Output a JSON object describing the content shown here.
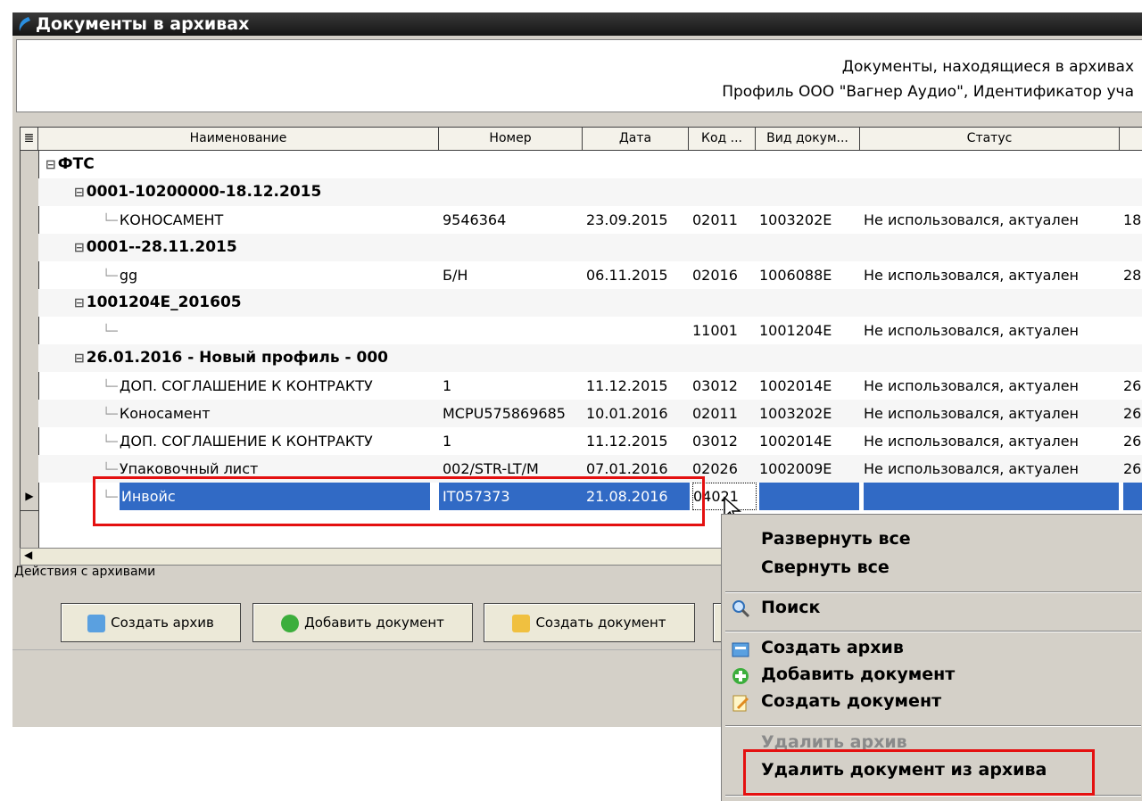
{
  "window": {
    "title": "Документы в архивах"
  },
  "header": {
    "line1": "Документы, находящиеся в архивах",
    "line2": "Профиль ООО \"Вагнер Аудио\", Идентификатор уча"
  },
  "grid": {
    "columns": [
      "Наименование",
      "Номер",
      "Дата",
      "Код ...",
      "Вид докум...",
      "Статус"
    ],
    "rows": [
      {
        "name": "ФТС",
        "level": 0,
        "group": true
      },
      {
        "name": "0001-10200000-18.12.2015",
        "level": 1,
        "group": true
      },
      {
        "name": "КОНОСАМЕНТ",
        "level": 2,
        "number": "9546364",
        "date": "23.09.2015",
        "code": "02011",
        "kind": "1003202E",
        "status": "Не использовался, актуален",
        "extra": "18"
      },
      {
        "name": "0001--28.11.2015",
        "level": 1,
        "group": true
      },
      {
        "name": "gg",
        "level": 2,
        "number": "Б/Н",
        "date": "06.11.2015",
        "code": "02016",
        "kind": "1006088E",
        "status": "Не использовался, актуален",
        "extra": "28"
      },
      {
        "name": "1001204E_201605",
        "level": 1,
        "group": true
      },
      {
        "name": "",
        "level": 2,
        "number": "",
        "date": "",
        "code": "11001",
        "kind": "1001204E",
        "status": "Не использовался, актуален",
        "extra": ""
      },
      {
        "name": "26.01.2016 - Новый профиль - 000",
        "level": 1,
        "group": true
      },
      {
        "name": "ДОП. СОГЛАШЕНИЕ К КОНТРАКТУ",
        "level": 2,
        "number": "1",
        "date": "11.12.2015",
        "code": "03012",
        "kind": "1002014E",
        "status": "Не использовался, актуален",
        "extra": "26"
      },
      {
        "name": "Коносамент",
        "level": 2,
        "number": "MCPU575869685",
        "date": "10.01.2016",
        "code": "02011",
        "kind": "1003202E",
        "status": "Не использовался, актуален",
        "extra": "26"
      },
      {
        "name": "ДОП. СОГЛАШЕНИЕ К КОНТРАКТУ",
        "level": 2,
        "number": "1",
        "date": "11.12.2015",
        "code": "03012",
        "kind": "1002014E",
        "status": "Не использовался, актуален",
        "extra": "26"
      },
      {
        "name": "Упаковочный лист",
        "level": 2,
        "number": "002/STR-LT/M",
        "date": "07.01.2016",
        "code": "02026",
        "kind": "1002009E",
        "status": "Не использовался, актуален",
        "extra": "26"
      },
      {
        "name": "Инвойс",
        "level": 2,
        "number": "IT057373",
        "date": "21.08.2016",
        "code": "04021",
        "kind": "",
        "status": "",
        "extra": "",
        "selected": true
      }
    ]
  },
  "actions": {
    "label": "Действия с архивами",
    "create_archive": "Создать архив",
    "add_document": "Добавить документ",
    "create_document": "Создать документ"
  },
  "context_menu": {
    "expand_all": "Развернуть все",
    "collapse_all": "Свернуть все",
    "search": "Поиск",
    "create_archive": "Создать архив",
    "add_document": "Добавить документ",
    "create_document": "Создать документ",
    "delete_archive": "Удалить архив",
    "delete_document": "Удалить документ из архива"
  },
  "colors": {
    "selection": "#316ac5",
    "highlight": "#e41010",
    "titlebar": "#1e1e1e"
  }
}
